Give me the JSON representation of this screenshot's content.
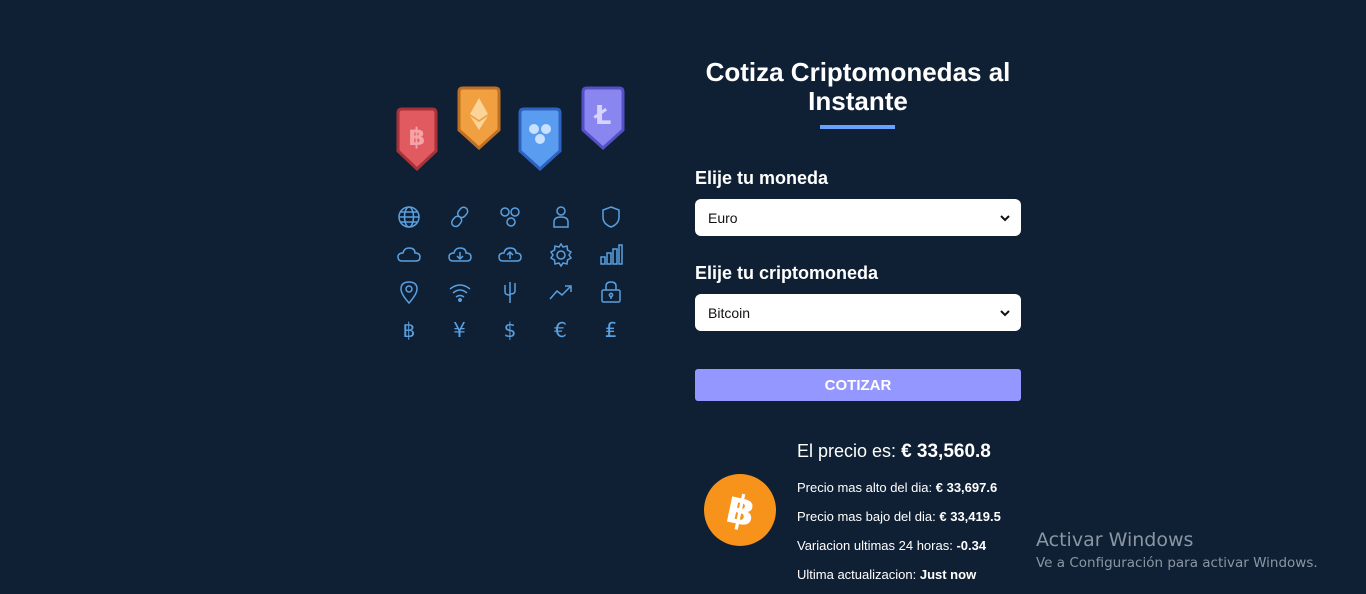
{
  "form": {
    "title": "Cotiza Criptomonedas al Instante",
    "currency_label": "Elije tu moneda",
    "currency_value": "Euro",
    "crypto_label": "Elije tu criptomoneda",
    "crypto_value": "Bitcoin",
    "submit_label": "COTIZAR"
  },
  "result": {
    "price_label": "El precio es:",
    "price_value": "€ 33,560.8",
    "high_label": "Precio mas alto del dia:",
    "high_value": "€ 33,697.6",
    "low_label": "Precio mas bajo del dia:",
    "low_value": "€ 33,419.5",
    "change_label": "Variacion ultimas 24 horas:",
    "change_value": "-0.34",
    "updated_label": "Ultima actualizacion:",
    "updated_value": "Just now"
  },
  "illustration": {
    "tags": [
      "bitcoin-tag-icon",
      "ethereum-tag-icon",
      "ripple-tag-icon",
      "litecoin-tag-icon"
    ],
    "glyphs": {
      "baht": "฿",
      "yen": "¥",
      "dollar": "$",
      "euro": "€",
      "lira": "₤"
    }
  },
  "watermark": {
    "title": "Activar Windows",
    "subtitle": "Ve a Configuración para activar Windows."
  },
  "colors": {
    "background": "#0f2034",
    "accent": "#9497ff",
    "underline": "#66a2fe",
    "bitcoin": "#f7931a",
    "icon_blue": "#5aa0e0"
  }
}
